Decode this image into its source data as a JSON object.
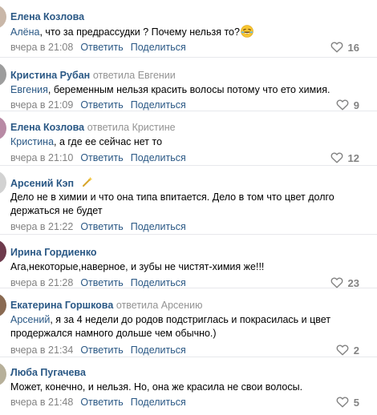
{
  "colors": {
    "link": "#2a5885",
    "muted": "#828282",
    "reply": "#939393",
    "divider": "#e7e8ec"
  },
  "comments": [
    {
      "author": "Елена Козлова",
      "reply_to": "",
      "mention": "Алёна",
      "text": ", что за предрассудки ? Почему нельзя то?",
      "emoji": "laughing-tears-emoji",
      "date": "вчера в 21:08",
      "reply_label": "Ответить",
      "share_label": "Поделиться",
      "likes": "16"
    },
    {
      "author": "Кристина Рубан",
      "reply_to": "ответила Евгении",
      "mention": "Евгения",
      "text": ", беременным нельзя красить волосы потому что ето химия.",
      "date": "вчера в 21:09",
      "reply_label": "Ответить",
      "share_label": "Поделиться",
      "likes": "9"
    },
    {
      "author": "Елена Козлова",
      "reply_to": "ответила Кристине",
      "mention": "Кристина",
      "text": ", а где ее сейчас нет то",
      "date": "вчера в 21:10",
      "reply_label": "Ответить",
      "share_label": "Поделиться",
      "likes": "12"
    },
    {
      "author": "Арсений Кэп",
      "reply_to": "",
      "badge": "magic-wand-icon",
      "mention": "",
      "text": "Дело не в химии и что она типа впитается. Дело в том что цвет долго держаться не будет",
      "date": "вчера в 21:22",
      "reply_label": "Ответить",
      "share_label": "Поделиться",
      "likes": ""
    },
    {
      "author": "Ирина Гордиенко",
      "reply_to": "",
      "mention": "",
      "text": "Ага,некоторые,наверное, и зубы не чистят-химия же!!!",
      "date": "вчера в 21:28",
      "reply_label": "Ответить",
      "share_label": "Поделиться",
      "likes": "23"
    },
    {
      "author": "Екатерина Горшкова",
      "reply_to": "ответила Арсению",
      "mention": "Арсений",
      "text": ", я за 4 недели до родов подстриглась и покрасилась и цвет продержался намного дольше чем обычно.)",
      "date": "вчера в 21:34",
      "reply_label": "Ответить",
      "share_label": "Поделиться",
      "likes": "2"
    },
    {
      "author": "Люба Пугачева",
      "reply_to": "",
      "mention": "",
      "text": "Может, конечно, и нельзя. Но, она же красила не свои волосы.",
      "date": "вчера в 21:48",
      "reply_label": "Ответить",
      "share_label": "Поделиться",
      "likes": "5"
    }
  ]
}
